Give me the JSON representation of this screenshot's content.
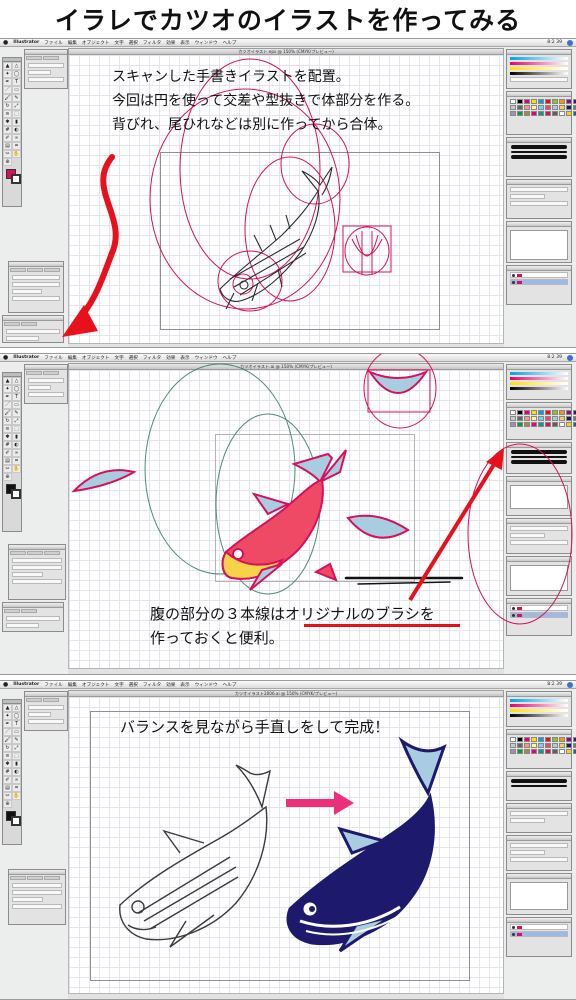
{
  "title": "イラレでカツオのイラストを作ってみる",
  "menubar": {
    "items": [
      "Illustrator",
      "ファイル",
      "編集",
      "オブジェクト",
      "文字",
      "選択",
      "フィルタ",
      "効果",
      "表示",
      "ウィンドウ",
      "ヘルプ"
    ],
    "clock": "8:2 39"
  },
  "panels": [
    {
      "window_title": "カツオイラスト.eps @ 150% (CMYK/プレビュー)",
      "caption_lines": [
        "スキャンした手書きイラストを配置。",
        "今回は円を使って交差や型抜きで体部分を作る。",
        "背びれ、尾ひれなどは別に作ってから合体。"
      ]
    },
    {
      "window_title": "カツオイラスト.ai @ 150% (CMYK/プレビュー)",
      "caption_lines": [
        "腹の部分の３本線はオリジナルのブラシを",
        "作っておくと便利。"
      ],
      "underline_phrase": "オリジナルのブラシ"
    },
    {
      "window_title": "カツオイラスト2006.ai @ 150% (CMYK/プレビュー)",
      "caption_lines": [
        "バランスを見ながら手直しをして完成！"
      ]
    }
  ],
  "colors": {
    "guide_magenta": "#d80f5b",
    "arrow_red": "#e8101a",
    "arrow_pink": "#ec2f7a",
    "fin_blue": "#a9cde0",
    "body_coral": "#ee4a66",
    "belly_yellow": "#f7d34a",
    "final_navy": "#1d1a6e"
  },
  "icons": {
    "tools": [
      "selection-tool",
      "direct-selection-tool",
      "magic-wand-tool",
      "lasso-tool",
      "pen-tool",
      "type-tool",
      "line-tool",
      "rectangle-tool",
      "paintbrush-tool",
      "pencil-tool",
      "rotate-tool",
      "scale-tool",
      "warp-tool",
      "free-transform-tool",
      "symbol-sprayer-tool",
      "graph-tool",
      "mesh-tool",
      "gradient-tool",
      "eyedropper-tool",
      "blend-tool",
      "live-paint-tool",
      "slice-tool",
      "scissors-tool",
      "hand-tool",
      "zoom-tool"
    ]
  }
}
